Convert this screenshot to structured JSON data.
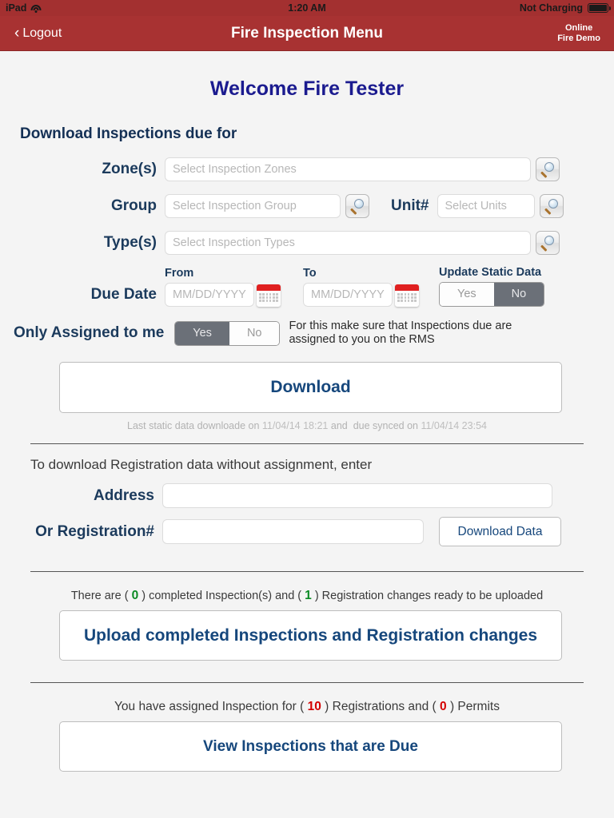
{
  "statusbar": {
    "device": "iPad",
    "time": "1:20 AM",
    "battery_text": "Not Charging"
  },
  "navbar": {
    "back_label": "Logout",
    "title": "Fire Inspection Menu",
    "status_line1": "Online",
    "status_line2": "Fire Demo"
  },
  "content": {
    "welcome": "Welcome Fire Tester",
    "section_title": "Download Inspections due for",
    "fields": {
      "zones_label": "Zone(s)",
      "zones_placeholder": "Select Inspection Zones",
      "group_label": "Group",
      "group_placeholder": "Select Inspection Group",
      "unit_label": "Unit#",
      "unit_placeholder": "Select Units",
      "types_label": "Type(s)",
      "types_placeholder": "Select Inspection Types",
      "due_date_label": "Due Date",
      "from_label": "From",
      "to_label": "To",
      "date_placeholder": "MM/DD/YYYY",
      "update_static_label": "Update Static Data",
      "update_static_yes": "Yes",
      "update_static_no": "No",
      "update_static_selected": "No",
      "assigned_label": "Only Assigned to me",
      "assigned_yes": "Yes",
      "assigned_no": "No",
      "assigned_selected": "Yes",
      "assigned_helper": "For this make sure that Inspections due are assigned to you on the RMS"
    },
    "download_button": "Download",
    "sync_prefix": "Last static data downloade on",
    "sync_static_stamp": "11/04/14 18:21",
    "sync_mid": "and",
    "sync_due_prefix": "due synced on",
    "sync_due_stamp": "11/04/14 23:54",
    "registration": {
      "heading": "To download Registration data without assignment, enter",
      "address_label": "Address",
      "address_value": "",
      "registration_label": "Or Registration#",
      "registration_value": "",
      "download_data_button": "Download Data"
    },
    "upload": {
      "text_1": "There are (",
      "completed_count": "0",
      "text_2": ") completed Inspection(s) and (",
      "registration_count": "1",
      "text_3": ") Registration changes ready to be uploaded",
      "button": "Upload completed Inspections and Registration changes"
    },
    "assigned_section": {
      "text_1": "You have assigned Inspection for (",
      "registrations_count": "10",
      "text_2": ") Registrations and (",
      "permits_count": "0",
      "text_3": ") Permits",
      "button": "View Inspections that are Due"
    }
  },
  "colors": {
    "nav_red": "#a83232",
    "welcome_blue": "#1b1b8f",
    "link_blue": "#16477c",
    "green": "#0b8a24",
    "red": "#d40000",
    "toggle_on": "#6b7078"
  }
}
